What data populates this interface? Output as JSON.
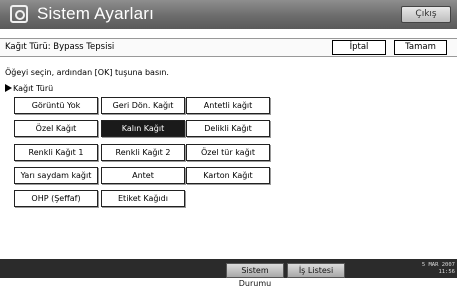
{
  "header": {
    "title": "Sistem Ayarları",
    "exit_label": "Çıkış",
    "icon": "settings-app-icon"
  },
  "titlebar": {
    "title": "Kağıt Türü: Bypass Tepsisi",
    "cancel_label": "İptal",
    "ok_label": "Tamam"
  },
  "main": {
    "instruction": "Öğeyi seçin, ardından [OK] tuşuna basın.",
    "section_label": "Kağıt Türü",
    "selected": "Kalın Kağıt",
    "options": [
      "Görüntü Yok",
      "Geri Dön. Kağıt",
      "Antetli kağıt",
      "Özel Kağıt",
      "Kalın Kağıt",
      "Delikli Kağıt",
      "Renkli Kağıt 1",
      "Renkli Kağıt 2",
      "Özel tür kağıt",
      "Yarı saydam kağıt",
      "Antet",
      "Karton Kağıt",
      "OHP (Şeffaf)",
      "Etiket Kağıdı"
    ]
  },
  "footer": {
    "status_label": "Sistem Durumu",
    "joblist_label": "İş Listesi",
    "date": "5 MAR 2007",
    "time": "11:56"
  }
}
